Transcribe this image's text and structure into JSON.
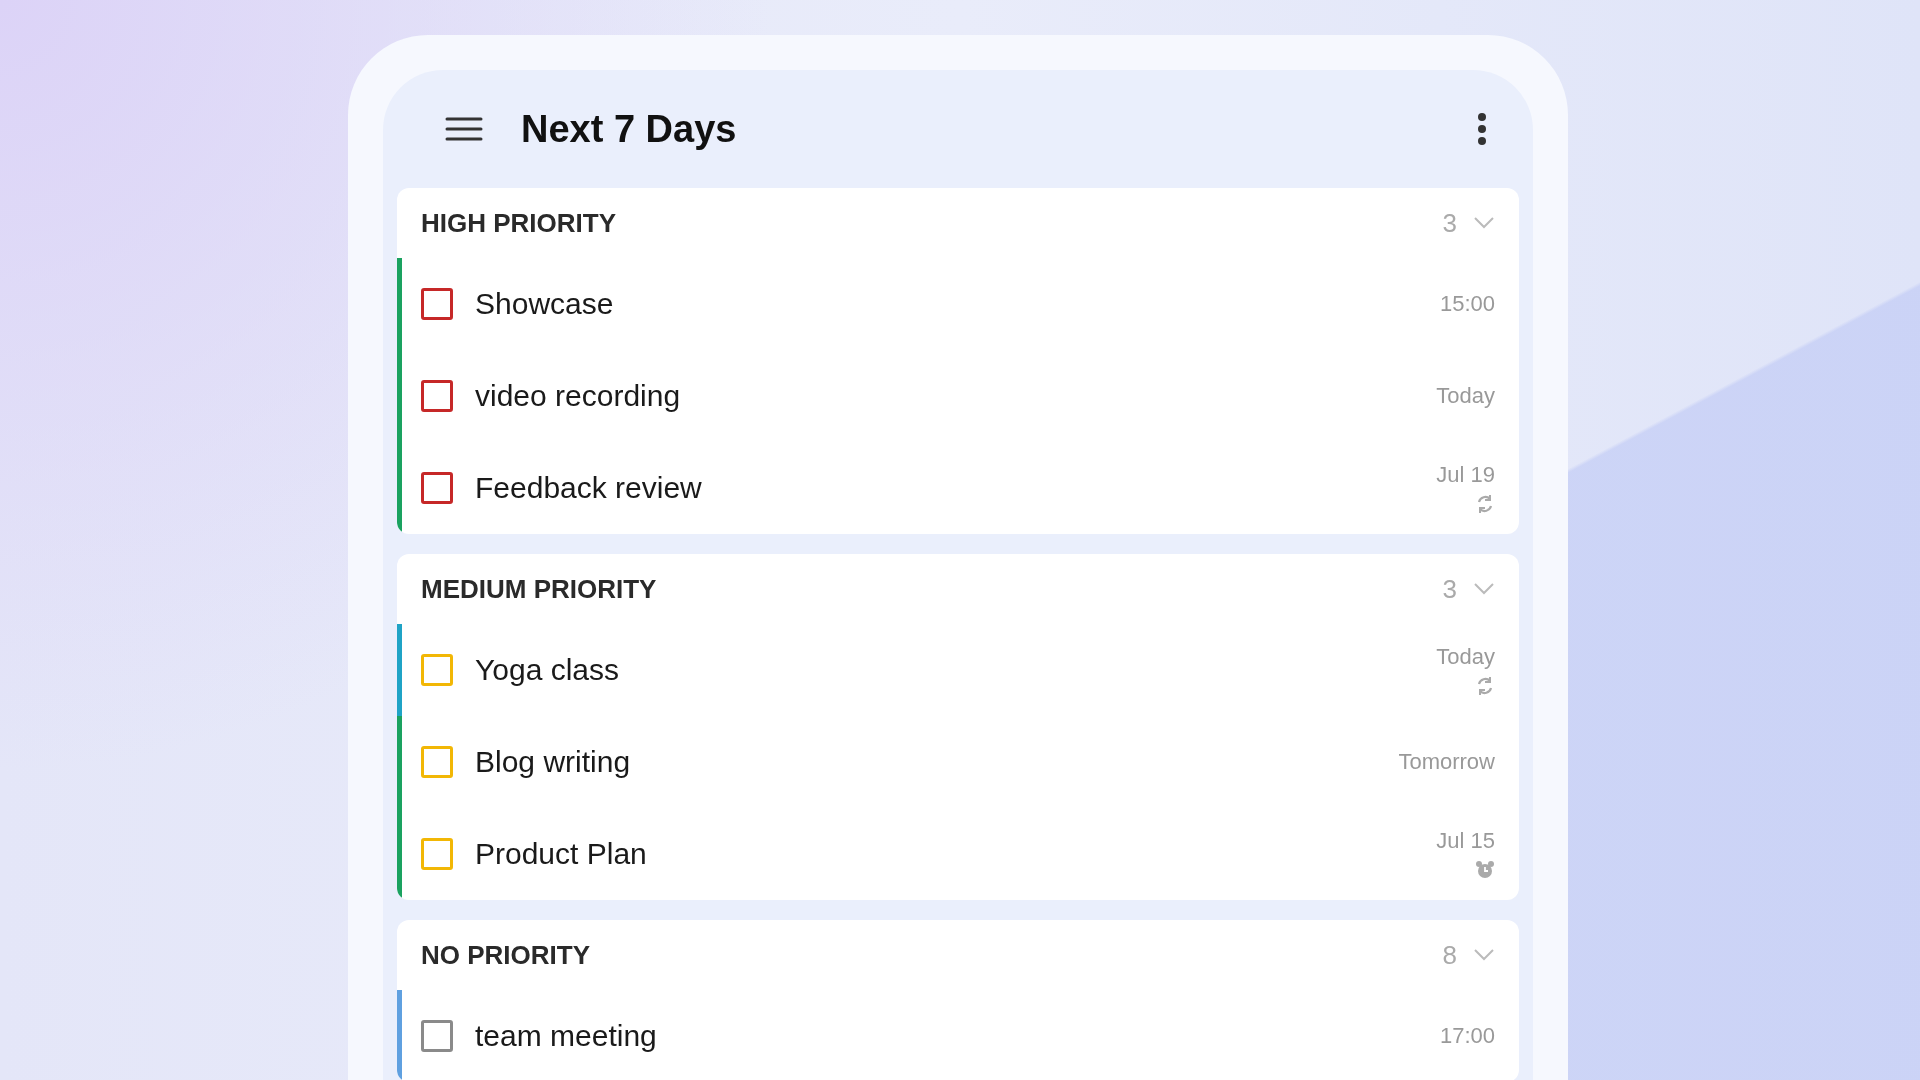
{
  "header": {
    "title": "Next 7 Days"
  },
  "sections": [
    {
      "title": "HIGH PRIORITY",
      "count": "3",
      "expanded": true,
      "color": "#c62828",
      "tasks": [
        {
          "kind": "plain",
          "title": "Showcase",
          "due": "15:00",
          "color": "#1aa260",
          "checked": false
        },
        {
          "kind": "plain",
          "title": "video recording",
          "due": "Today",
          "color": "#1aa260",
          "checked": false
        },
        {
          "kind": "repeat",
          "title": "Feedback review",
          "due": "Jul 19",
          "color": "#1aa260",
          "checked": false
        }
      ]
    },
    {
      "title": "MEDIUM PRIORITY",
      "count": "3",
      "expanded": true,
      "color": "#f2b705",
      "tasks": [
        {
          "kind": "repeat",
          "title": "Yoga class",
          "due": "Today",
          "color": "#1fa3c6",
          "checked": false
        },
        {
          "kind": "plain",
          "title": "Blog writing",
          "due": "Tomorrow",
          "color": "#1aa260",
          "checked": false
        },
        {
          "kind": "alarm",
          "title": "Product Plan",
          "due": "Jul 15",
          "color": "#1aa260",
          "checked": false
        }
      ]
    },
    {
      "title": "NO PRIORITY",
      "count": "8",
      "expanded": true,
      "color": "#8a8a8a",
      "tasks": [
        {
          "kind": "plain",
          "title": "team meeting",
          "due": "17:00",
          "color": "#5fa0e0",
          "checked": false
        }
      ]
    }
  ]
}
